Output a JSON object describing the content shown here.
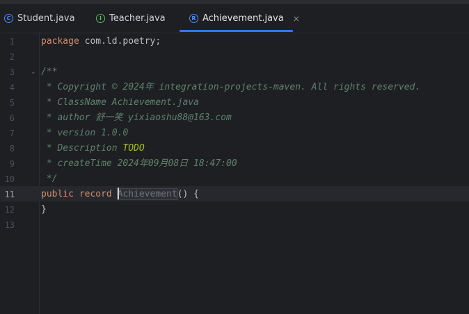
{
  "tabs": [
    {
      "icon": "class-icon",
      "icon_letter": "C",
      "icon_color": "#548af7",
      "label": "Student.java",
      "active": false
    },
    {
      "icon": "interface-icon",
      "icon_letter": "I",
      "icon_color": "#5fb865",
      "label": "Teacher.java",
      "active": false
    },
    {
      "icon": "record-icon",
      "icon_letter": "R",
      "icon_color": "#548af7",
      "label": "Achievement.java",
      "active": true,
      "close": "×"
    }
  ],
  "editor": {
    "current_line": 11,
    "line_numbers": [
      "1",
      "2",
      "3",
      "4",
      "5",
      "6",
      "7",
      "8",
      "9",
      "10",
      "11",
      "12",
      "13"
    ],
    "lines": {
      "l1_kw": "package",
      "l1_rest": " com.ld.poetry;",
      "l3": "/**",
      "l4": " * Copyright © 2024年 integration-projects-maven. All rights reserved.",
      "l5": " * ClassName Achievement.java",
      "l6": " * author 舒一笑 yixiaoshu88@163.com",
      "l7": " * version 1.0.0",
      "l8_pre": " * Description ",
      "l8_todo": "TODO",
      "l9": " * createTime 2024年09月08日 18:47:00",
      "l10": " */",
      "l11_kw1": "public",
      "l11_kw2": "record",
      "l11_ident": "Achievement",
      "l11_rest": "() {",
      "l12": "}"
    }
  },
  "colors": {
    "background": "#1e1f22",
    "keyword": "#cf8e6d",
    "doc_comment": "#5f826b",
    "todo": "#a8c023",
    "tab_accent": "#3574f0"
  }
}
